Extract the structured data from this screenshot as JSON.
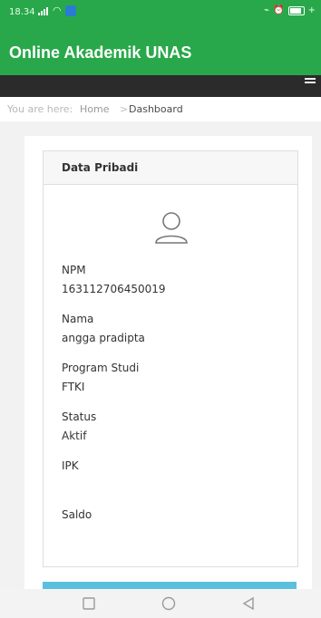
{
  "status": {
    "time": "18.34"
  },
  "app": {
    "title": "Online Akademik UNAS"
  },
  "breadcrumb": {
    "prefix": "You are here:",
    "home": "Home",
    "separator": ">",
    "current": "Dashboard"
  },
  "panel": {
    "title": "Data Pribadi",
    "fields": [
      {
        "label": "NPM",
        "value": "163112706450019"
      },
      {
        "label": "Nama",
        "value": "angga pradipta"
      },
      {
        "label": "Program Studi",
        "value": "FTKI"
      },
      {
        "label": "Status",
        "value": "Aktif"
      },
      {
        "label": "IPK",
        "value": ""
      },
      {
        "label": "Saldo",
        "value": ""
      }
    ]
  },
  "colors": {
    "appbar": "#28a84a",
    "navbar": "#2b2b2b",
    "accent": "#5bc0de"
  },
  "icons": {
    "avatar": "user-icon",
    "menu": "hamburger-icon",
    "nav": [
      "square-icon",
      "circle-icon",
      "triangle-back-icon"
    ]
  }
}
